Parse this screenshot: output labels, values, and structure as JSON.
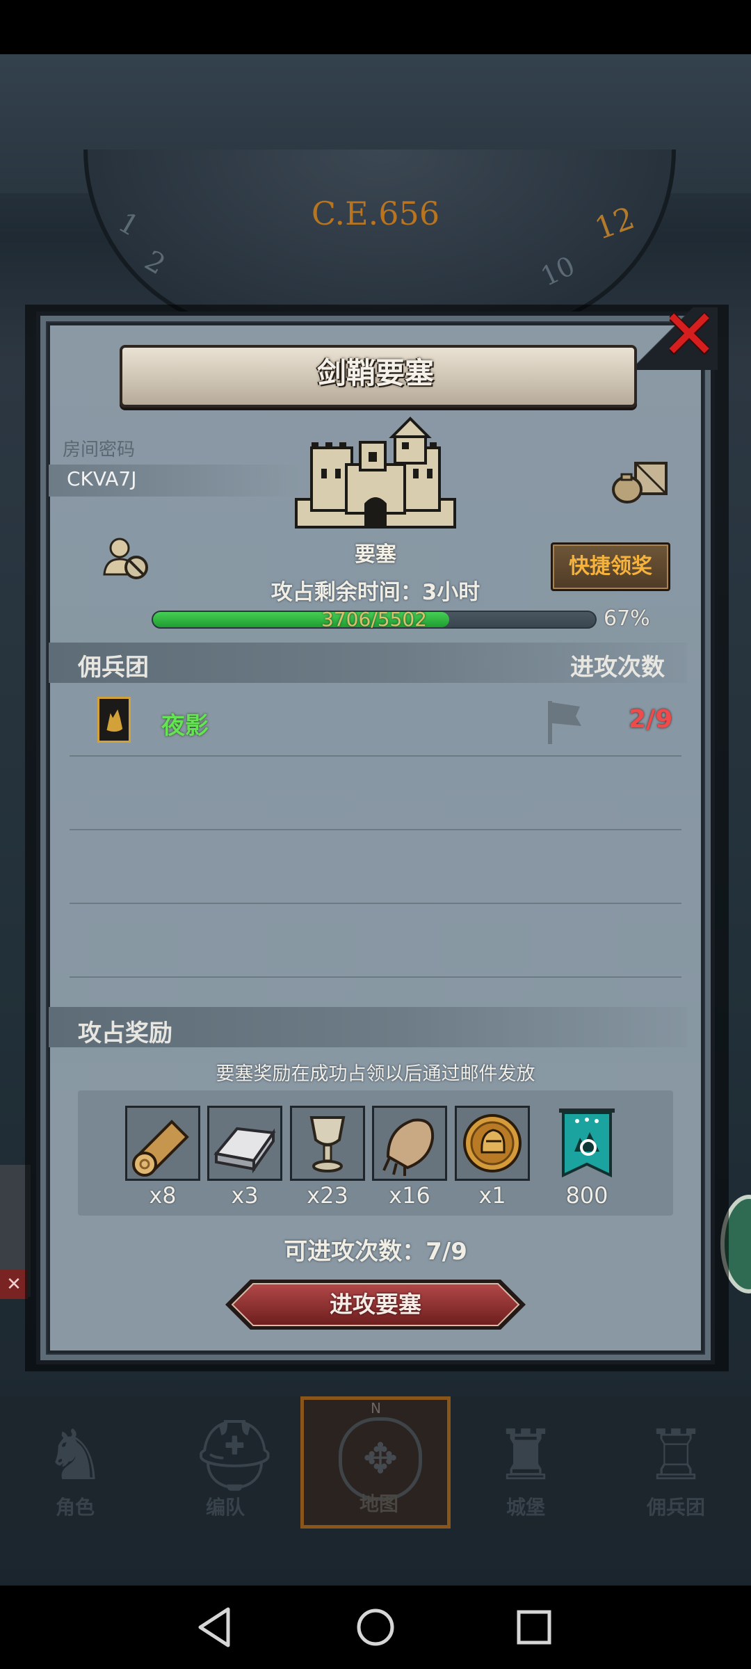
{
  "background": {
    "era": "C.E.656",
    "dial_numbers": [
      "1",
      "2",
      "10",
      "12"
    ]
  },
  "dialog": {
    "title": "剑鞘要塞",
    "room_label": "房间密码",
    "room_code": "CKVA7J",
    "building_label": "要塞",
    "quick_claim_label": "快捷领奖",
    "time_remaining": "攻占剩余时间：3小时",
    "progress": {
      "current": 3706,
      "total": 5502,
      "text": "3706/5502",
      "percent_text": "67%",
      "fraction": 0.67
    },
    "mercenary_header": "佣兵团",
    "attacks_header": "进攻次数",
    "mercenaries": [
      {
        "name": "夜影",
        "attacks": "2/9"
      }
    ],
    "reward_header": "攻占奖励",
    "reward_note": "要塞奖励在成功占领以后通过邮件发放",
    "rewards": [
      {
        "item": "log-icon",
        "qty": "x8"
      },
      {
        "item": "iron-ingot-icon",
        "qty": "x3"
      },
      {
        "item": "goblet-icon",
        "qty": "x23"
      },
      {
        "item": "fur-pelt-icon",
        "qty": "x16"
      },
      {
        "item": "knight-medal-icon",
        "qty": "x1"
      },
      {
        "item": "guild-banner-icon",
        "qty": "800"
      }
    ],
    "attempts_text": "可进攻次数：7/9",
    "attack_button": "进攻要塞",
    "close_icon": "close-icon"
  },
  "nav": {
    "items": [
      {
        "label": "角色",
        "icon": "knight-icon"
      },
      {
        "label": "编队",
        "icon": "helmet-icon"
      },
      {
        "label": "地图",
        "icon": "compass-map-icon",
        "active": true,
        "compass_letter": "N"
      },
      {
        "label": "城堡",
        "icon": "castle-icon"
      },
      {
        "label": "佣兵团",
        "icon": "tower-icon"
      }
    ]
  },
  "colors": {
    "accent_orange": "#f5b33e",
    "progress_green": "#2fbf3f",
    "attack_count_red": "#f04b4b",
    "merc_name_green": "#64e353",
    "close_red": "#d51f1f"
  }
}
